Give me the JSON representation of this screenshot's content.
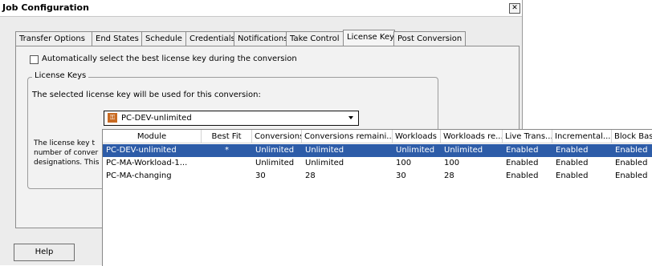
{
  "window": {
    "title": "Job Configuration",
    "close_glyph": "✕"
  },
  "tabs": [
    {
      "label": "Transfer Options"
    },
    {
      "label": "End States"
    },
    {
      "label": "Schedule"
    },
    {
      "label": "Credentials"
    },
    {
      "label": "Notifications"
    },
    {
      "label": "Take Control"
    },
    {
      "label": "License Key",
      "active": true
    },
    {
      "label": "Post Conversion"
    }
  ],
  "license_tab": {
    "auto_select_label": "Automatically select the best license key during the conversion",
    "auto_select_checked": false,
    "group_title": "License Keys",
    "selected_label": "The selected license key will be used for this conversion:",
    "description_lines": [
      "The license key t",
      "number of conver",
      "designations. This"
    ],
    "combo": {
      "icon": "license-key-icon",
      "value": "PC-DEV-unlimited"
    }
  },
  "dropdown": {
    "columns": [
      "Module",
      "Best Fit",
      "Conversions",
      "Conversions remaini...",
      "Workloads",
      "Workloads re...",
      "Live Trans...",
      "Incremental...",
      "Block Bas"
    ],
    "rows": [
      {
        "cells": [
          "PC-DEV-unlimited",
          "*",
          "Unlimited",
          "Unlimited",
          "Unlimited",
          "Unlimited",
          "Enabled",
          "Enabled",
          "Enabled"
        ],
        "selected": true
      },
      {
        "cells": [
          "PC-MA-Workload-1...",
          "",
          "Unlimited",
          "Unlimited",
          "100",
          "100",
          "Enabled",
          "Enabled",
          "Enabled"
        ],
        "selected": false
      },
      {
        "cells": [
          "PC-MA-changing",
          "",
          "30",
          "28",
          "30",
          "28",
          "Enabled",
          "Enabled",
          "Enabled"
        ],
        "selected": false
      }
    ]
  },
  "footer": {
    "help_label": "Help"
  }
}
